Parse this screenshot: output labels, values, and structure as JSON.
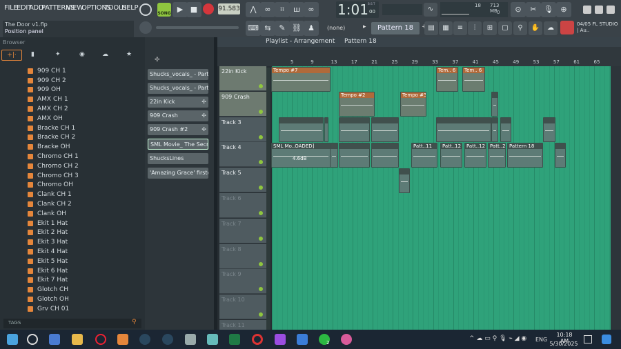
{
  "menu": [
    "FILE",
    "EDIT",
    "ADD",
    "PATTERNS",
    "VIEW",
    "OPTIONS",
    "TOOLS",
    "HELP"
  ],
  "song_button": "SONG",
  "tempo": "91.583",
  "time": "1:01",
  "time_small": "00",
  "bst": "B:S:T",
  "cpu": "18",
  "mem": "713 MB",
  "mem_small": "0",
  "project_title": "The Door v1.flp",
  "hint": "Position panel",
  "browser_label": "Browser",
  "pattern_none": "(none)",
  "pattern_name": "Pattern 18",
  "news": "04/05  FL STUDIO | Au..",
  "playlist_title": "Playlist - Arrangement",
  "playlist_pattern": "Pattern 18",
  "browser_items": [
    "909 CH 1",
    "909 CH 2",
    "909 OH",
    "AMX CH 1",
    "AMX CH 2",
    "AMX OH",
    "Bracke CH 1",
    "Bracke CH 2",
    "Bracke OH",
    "Chromo CH 1",
    "Chromo CH 2",
    "Chromo CH 3",
    "Chromo OH",
    "Clank CH 1",
    "Clank CH 2",
    "Clank OH",
    "Ekit 1 Hat",
    "Ekit 2 Hat",
    "Ekit 3 Hat",
    "Ekit 4 Hat",
    "Ekit 5 Hat",
    "Ekit 6 Hat",
    "Ekit 7 Hat",
    "Glotch CH",
    "Glotch OH",
    "Grv CH 01"
  ],
  "tags_label": "TAGS",
  "channels": [
    "Shucks_vocals_ - Part_3",
    "Shucks_vocals_ - Part_1",
    "22in Kick",
    "909 Crash",
    "909 Crash #2",
    "SML Movie_ The Secret D..",
    "ShucksLines",
    "'Amazing Grace' firstearli.."
  ],
  "tracks": [
    "22in Kick",
    "909 Crash",
    "Track 3",
    "Track 4",
    "Track 5",
    "Track 6",
    "Track 7",
    "Track 8",
    "Track 9",
    "Track 10",
    "Track 11"
  ],
  "ruler": [
    "5",
    "9",
    "13",
    "17",
    "21",
    "25",
    "29",
    "33",
    "37",
    "41",
    "45",
    "49",
    "53",
    "57",
    "61",
    "65"
  ],
  "clips": {
    "tempo7": "Tempo #7",
    "tem6a": "Tem.. 6",
    "tem6b": "Tem.. 6",
    "tempo2": "Tempo #2",
    "tempo3": "Tempo #3",
    "sml": "SML Mo..OADED]",
    "db": "4.6dB",
    "patt11": "Patt..11",
    "patt12a": "Patt..12",
    "patt12b": "Patt..12",
    "patt2": "Patt..2",
    "pattern18": "Pattern 18"
  },
  "clock_time": "10:18 AM",
  "clock_date": "5/30/2025",
  "lang": "ENG",
  "badge": "2",
  "colors": {
    "accent": "#2fb07a",
    "playlist_grid": "#2fa27a",
    "clip": "#5d7b76"
  }
}
